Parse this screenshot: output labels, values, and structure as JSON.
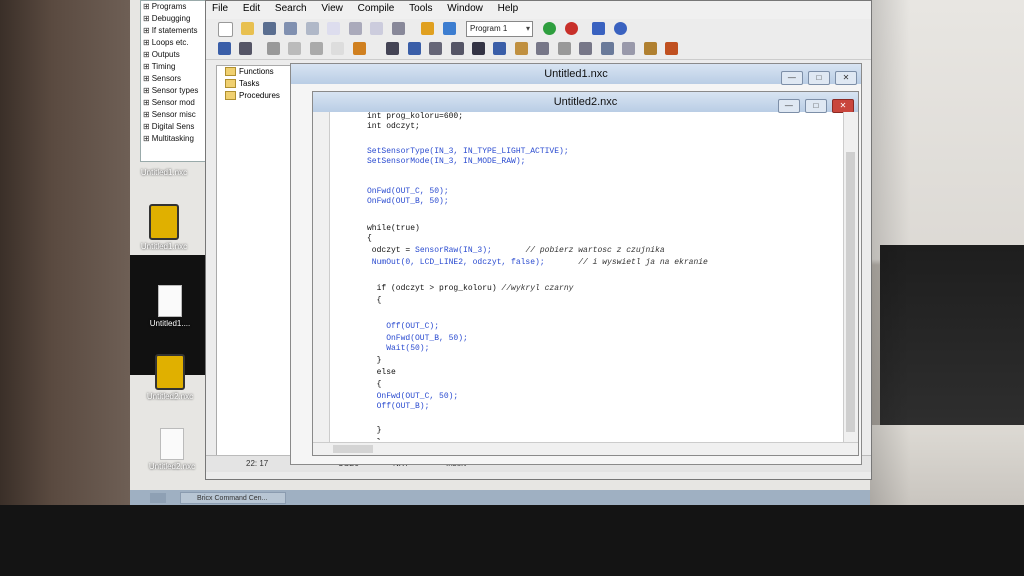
{
  "tree": {
    "items": [
      "Programs",
      "Debugging",
      "If statements",
      "Loops etc.",
      "Outputs",
      "Timing",
      "Sensors",
      "Sensor types",
      "Sensor mod",
      "Sensor misc",
      "Digital Sens",
      "Multitasking"
    ],
    "prefix": "⊞"
  },
  "desktop_icons": [
    {
      "label": "Untitled1.nxc"
    },
    {
      "label": "Untitled1.nxc"
    },
    {
      "label": "Untitled1...."
    },
    {
      "label": "Untitled2.nxc"
    },
    {
      "label": "Untitled2.nxc"
    }
  ],
  "menubar": {
    "items": [
      "File",
      "Edit",
      "Search",
      "View",
      "Compile",
      "Tools",
      "Window",
      "Help"
    ]
  },
  "toolbar": {
    "program_select": "Program 1"
  },
  "functions_panel": {
    "items": [
      "Functions",
      "Tasks",
      "Procedures"
    ]
  },
  "windows": {
    "win1_title": "Untitled1.nxc",
    "win2_title": "Untitled2.nxc",
    "minimize": "—",
    "maximize": "□",
    "close": "✕"
  },
  "code_lines": [
    "int prog_koloru=600;",
    "int odczyt;",
    "",
    "SetSensorType(IN_3, IN_TYPE_LIGHT_ACTIVE);",
    "SetSensorMode(IN_3, IN_MODE_RAW);",
    "",
    "OnFwd(OUT_C, 50);",
    "OnFwd(OUT_B, 50);",
    "",
    "while(true)",
    "{",
    " odczyt = SensorRaw(IN_3);       // pobierz wartosc z czujnika",
    " NumOut(0, LCD_LINE2, odczyt, false);       // i wyswietl ja na ekranie",
    "",
    "  if (odczyt > prog_koloru) //wykryl czarny",
    "  {",
    "",
    "    Off(OUT_C);",
    "    OnFwd(OUT_B, 50);",
    "    Wait(50);",
    "  }",
    "  else",
    "  {",
    "  OnFwd(OUT_C, 50);",
    "  Off(OUT_B);",
    "",
    "  }",
    "  }",
    "}"
  ],
  "statusbar": {
    "position": "22: 17",
    "port": "USB0",
    "device": "NXT",
    "mode": "Insert"
  },
  "taskbar": {
    "item": "Bricx Command Cen..."
  }
}
